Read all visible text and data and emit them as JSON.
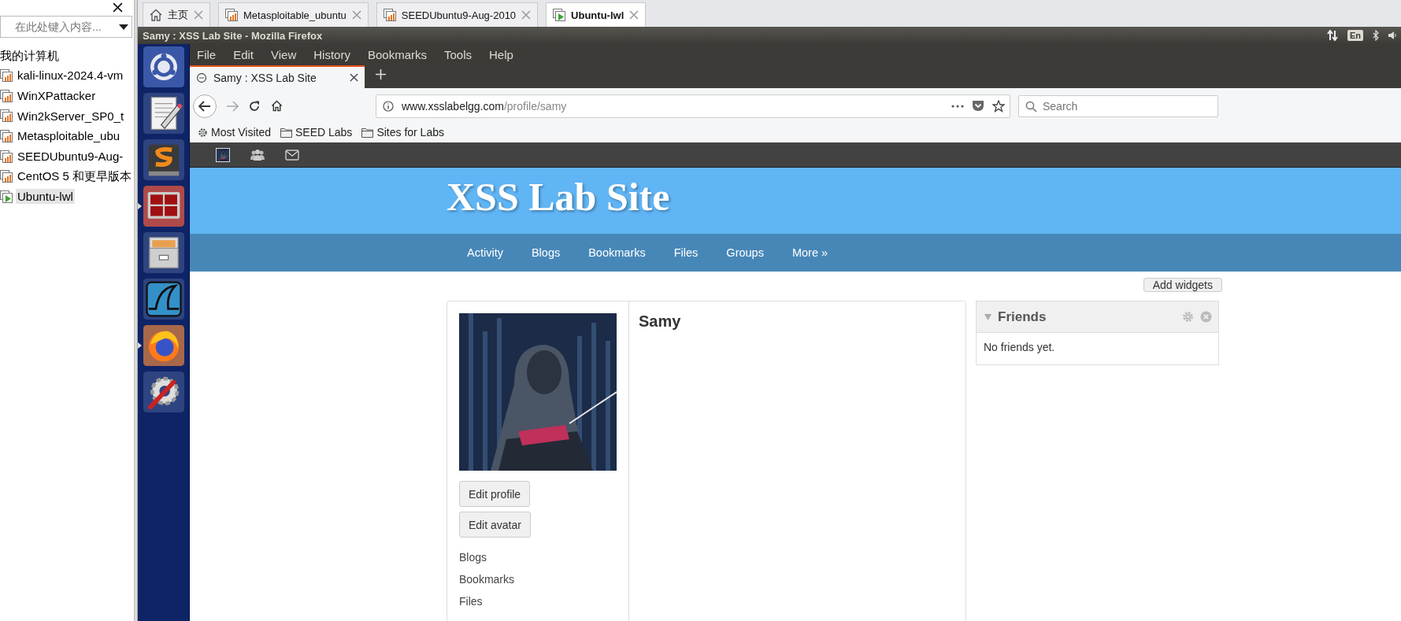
{
  "library": {
    "search": {
      "placeholder": "在此处键入内容..."
    },
    "tree": [
      {
        "label": "我的计算机",
        "children": [
          {
            "label": "kali-linux-2024.4-vm",
            "selected": false,
            "running": false
          },
          {
            "label": "WinXPattacker",
            "selected": false,
            "running": false
          },
          {
            "label": "Win2kServer_SP0_t",
            "selected": false,
            "running": false
          },
          {
            "label": "Metasploitable_ubu",
            "selected": false,
            "running": false
          },
          {
            "label": "SEEDUbuntu9-Aug-",
            "selected": false,
            "running": false
          },
          {
            "label": "CentOS 5 和更早版本",
            "selected": false,
            "running": false
          },
          {
            "label": "Ubuntu-lwl",
            "selected": true,
            "running": true
          }
        ]
      }
    ]
  },
  "vm_tabs": [
    {
      "label": "主页",
      "kind": "home",
      "selected": false
    },
    {
      "label": "Metasploitable_ubuntu",
      "kind": "vm",
      "selected": false
    },
    {
      "label": "SEEDUbuntu9-Aug-2010",
      "kind": "vm",
      "selected": false
    },
    {
      "label": "Ubuntu-lwl",
      "kind": "vm_running",
      "selected": true
    }
  ],
  "top_bar": {
    "title": "Samy : XSS Lab Site - Mozilla Firefox",
    "keyboard_layout": "En"
  },
  "launcher": [
    {
      "kind": "dash",
      "running": false
    },
    {
      "kind": "editor",
      "running": false
    },
    {
      "kind": "sublime",
      "running": false
    },
    {
      "kind": "terminal",
      "running": true
    },
    {
      "kind": "files",
      "running": false
    },
    {
      "kind": "wireshark",
      "running": false
    },
    {
      "kind": "firefox",
      "running": true
    },
    {
      "kind": "settings",
      "running": false
    }
  ],
  "firefox": {
    "menu": [
      "File",
      "Edit",
      "View",
      "History",
      "Bookmarks",
      "Tools",
      "Help"
    ],
    "tabs": [
      {
        "label": "Samy : XSS Lab Site",
        "selected": true
      }
    ],
    "address": {
      "host": "www.xsslabelgg.com",
      "path": "/profile/samy"
    },
    "search": {
      "placeholder": "Search"
    },
    "bookmarks": [
      {
        "label": "Most Visited",
        "kind": "gear"
      },
      {
        "label": "SEED Labs",
        "kind": "folder"
      },
      {
        "label": "Sites for Labs",
        "kind": "folder"
      }
    ]
  },
  "site": {
    "title": "XSS Lab Site",
    "nav": [
      "Activity",
      "Blogs",
      "Bookmarks",
      "Files",
      "Groups",
      "More »"
    ],
    "add_widgets": "Add widgets",
    "profile": {
      "name": "Samy",
      "buttons": [
        "Edit profile",
        "Edit avatar"
      ],
      "links": [
        "Blogs",
        "Bookmarks",
        "Files"
      ]
    },
    "friends_widget": {
      "title": "Friends",
      "body": "No friends yet."
    }
  }
}
